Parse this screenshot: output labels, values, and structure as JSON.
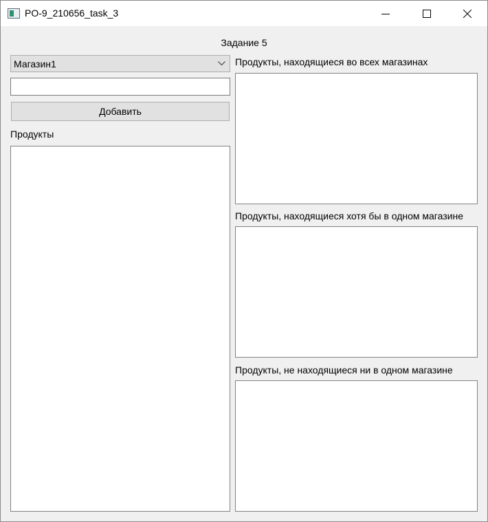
{
  "window": {
    "title": "PO-9_210656_task_3"
  },
  "heading": "Задание 5",
  "store_combo": {
    "selected": "Магазин1"
  },
  "product_input": {
    "value": ""
  },
  "add_button": {
    "label": "Добавить"
  },
  "products": {
    "label": "Продукты",
    "items": []
  },
  "in_all_stores": {
    "label": "Продукты, находящиеся во всех магазинах",
    "items": []
  },
  "in_any_store": {
    "label": "Продукты, находящиеся хотя бы в одном магазине",
    "items": []
  },
  "in_no_store": {
    "label": "Продукты, не находящиеся ни в одном магазине",
    "items": []
  },
  "icons": {
    "app": "app-window-icon",
    "minimize": "minimize-icon",
    "maximize": "maximize-icon",
    "close": "close-icon",
    "dropdown": "chevron-down-icon"
  }
}
